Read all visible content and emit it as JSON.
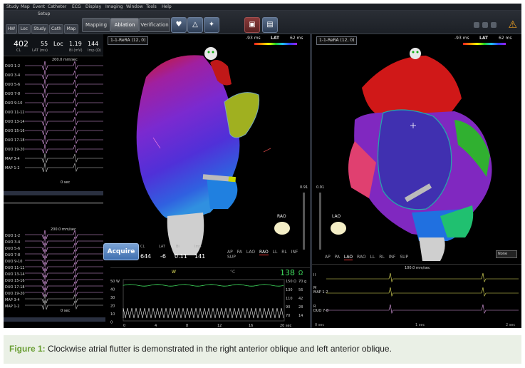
{
  "menu": [
    "Study",
    "Map",
    "Event",
    "Catheter",
    "ECG",
    "Display",
    "Imaging",
    "Window",
    "Tools",
    "Help"
  ],
  "toolbar": {
    "setup_label": "Setup",
    "setup_buttons": [
      "HW",
      "Loc",
      "Study",
      "Cath",
      "Map"
    ],
    "modes": [
      "Mapping",
      "Ablation",
      "Verification"
    ],
    "active_mode": "Ablation"
  },
  "left_panel": {
    "readouts": [
      {
        "value": "402",
        "label": "CL"
      },
      {
        "value": "55",
        "label": "LAT (ms)"
      },
      {
        "value": "Loc",
        "label": ""
      },
      {
        "value": "1.19",
        "label": "Bi (mV)"
      },
      {
        "value": "144",
        "label": "Imp (Ω)"
      }
    ],
    "sweep_top": "200.0 mm/sec",
    "sweep_bottom": "200.0 mm/sec",
    "channels_top": [
      "DUO 1-2",
      "DUO 3-4",
      "DUO 5-6",
      "DUO 7-8",
      "DUO 9-10",
      "DUO 11-12",
      "DUO 13-14",
      "DUO 15-16",
      "DUO 17-18",
      "DUO 19-20",
      "MAP 3-4",
      "MAP 1-2"
    ],
    "channels_bottom": [
      "DUO 1-2",
      "DUO 3-4",
      "DUO 5-6",
      "DUO 7-8",
      "DUO 9-10",
      "DUO 11-12",
      "DUO 13-14",
      "DUO 15-16",
      "DUO 17-18",
      "DUO 19-20",
      "MAP 3-4",
      "MAP 1-2"
    ],
    "time_top": "0 sec",
    "time_bottom": "0 sec"
  },
  "controls": {
    "big_number": "18",
    "small_number": "8",
    "acquire_label": "Acquire"
  },
  "ablation_readout": {
    "labels": [
      "CL",
      "LAT",
      "Bi",
      "Imp"
    ],
    "values": [
      "644",
      "-6",
      "0.11",
      "141"
    ]
  },
  "map_left": {
    "map_name": "1-1-ReRA (12, 0)",
    "lat_label": "LAT",
    "lat_min": "-93 ms",
    "lat_max": "62 ms",
    "orientation": "RAO",
    "slider_value": "0.91",
    "views": [
      "AP",
      "PA",
      "LAO",
      "RAO",
      "LL",
      "RL",
      "INF",
      "SUP"
    ],
    "active_view": "RAO"
  },
  "map_right": {
    "map_name": "1-1-ReRA (12, 0)",
    "lat_label": "LAT",
    "lat_min": "-93 ms",
    "lat_max": "62 ms",
    "orientation": "LAO",
    "slider_value": "0.91",
    "views": [
      "AP",
      "PA",
      "LAO",
      "RAO",
      "LL",
      "RL",
      "INF",
      "SUP"
    ],
    "active_view": "LAO",
    "none_select": "None"
  },
  "vitals": {
    "label_w": "W",
    "label_c": "°C",
    "temp_value": "138",
    "temp_unit": "Ω",
    "left_ticks": [
      "50 W",
      "40",
      "30",
      "20",
      "10",
      "0"
    ],
    "right_ticks": [
      "150 Ω",
      "130",
      "110",
      "90",
      "70"
    ],
    "right_ticks2": [
      "70 g",
      "56",
      "42",
      "28",
      "14"
    ],
    "bottom_ticks": [
      "0",
      "4",
      "8",
      "12",
      "16",
      "20 sec"
    ]
  },
  "ecg_bottom": {
    "sweep": "100.0 mm/sec",
    "channels": [
      "II",
      "M",
      "MAP 1-2",
      "R",
      "DUO 7-8"
    ],
    "time_start": "0 sec",
    "time_mid": "1 sec",
    "time_end": "2 sec"
  },
  "caption": {
    "figure_label": "Figure 1:",
    "text": "Clockwise atrial flutter is demonstrated in the right anterior oblique and left anterior oblique."
  },
  "colors": {
    "caption_accent": "#6a9e34",
    "caption_bg": "#eaf0e6",
    "vitals_green": "#40e060"
  }
}
